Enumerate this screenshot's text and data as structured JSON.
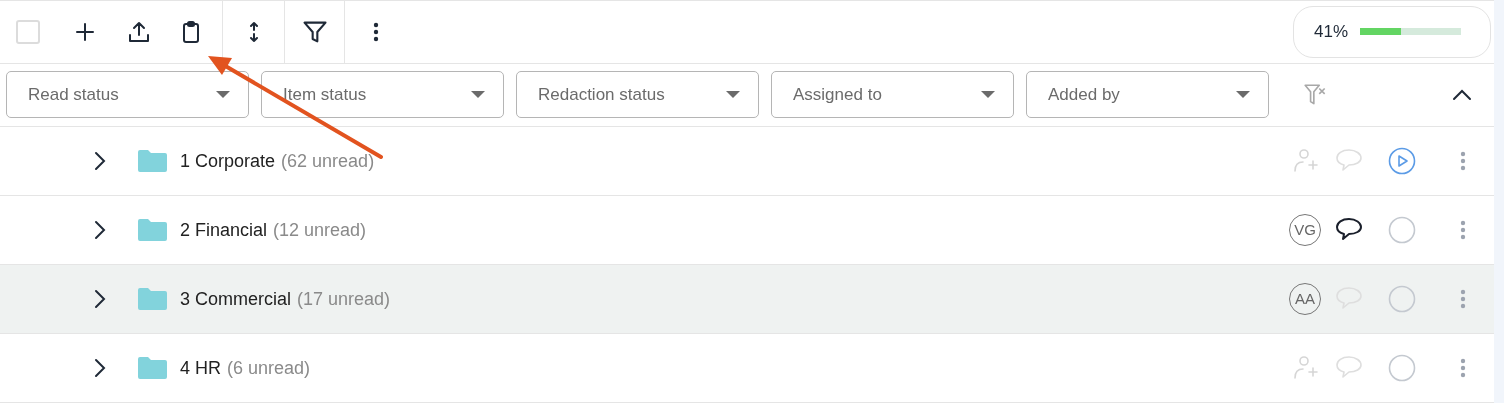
{
  "select_all": {
    "checked": false
  },
  "progress": {
    "reading": "41%",
    "level": 0.41
  },
  "filters": [
    {
      "placeholder": "Read status"
    },
    {
      "placeholder": "Item status"
    },
    {
      "placeholder": "Redaction status"
    },
    {
      "placeholder": "Assigned to"
    },
    {
      "placeholder": "Added by"
    }
  ],
  "rows": [
    {
      "label": "1 Corporate",
      "unread": "(62 unread)",
      "selected": false,
      "has_comments": false,
      "in_progress": true
    },
    {
      "label": "2 Financial",
      "unread": "(12 unread)",
      "selected": false,
      "assignee": "VG",
      "has_comments": true,
      "in_progress": false
    },
    {
      "label": "3 Commercial",
      "unread": "(17 unread)",
      "selected": true,
      "assignee": "AA",
      "has_comments": false,
      "in_progress": false
    },
    {
      "label": "4 HR",
      "unread": "(6 unread)",
      "selected": false,
      "has_comments": false,
      "in_progress": false
    }
  ]
}
